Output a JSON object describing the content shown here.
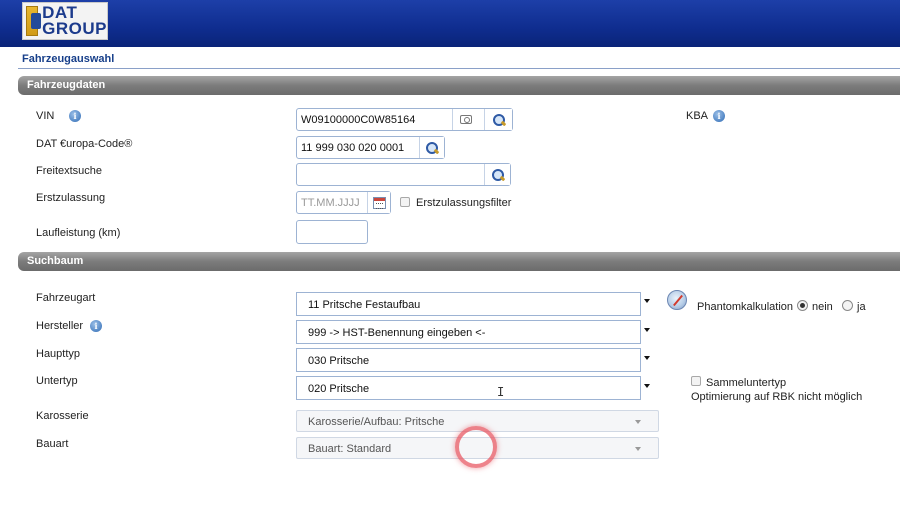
{
  "header": {
    "logo_line1": "DAT",
    "logo_line2": "GROUP",
    "page_title": "Fahrzeugauswahl"
  },
  "sections": {
    "vehicle_data": "Fahrzeugdaten",
    "search_tree": "Suchbaum"
  },
  "vehicle_data": {
    "vin_label": "VIN",
    "vin_value": "W09100000C0W85164",
    "kba_label": "KBA",
    "dat_code_label": "DAT €uropa-Code®",
    "dat_code_value": "11 999 030 020 0001",
    "freetext_label": "Freitextsuche",
    "freetext_value": "",
    "first_reg_label": "Erstzulassung",
    "first_reg_placeholder": "TT.MM.JJJJ",
    "first_reg_filter_label": "Erstzulassungsfilter",
    "mileage_label": "Laufleistung (km)",
    "mileage_value": ""
  },
  "search_tree": {
    "vehicle_type_label": "Fahrzeugart",
    "vehicle_type_value": "11 Pritsche Festaufbau",
    "manufacturer_label": "Hersteller",
    "manufacturer_value": "999 -> HST-Benennung eingeben <-",
    "main_type_label": "Haupttyp",
    "main_type_value": "030 Pritsche",
    "sub_type_label": "Untertyp",
    "sub_type_value": "020 Pritsche",
    "body_label": "Karosserie",
    "body_value": "Karosserie/Aufbau: Pritsche",
    "build_label": "Bauart",
    "build_value": "Bauart: Standard",
    "phantom_label": "Phantomkalkulation",
    "phantom_no": "nein",
    "phantom_yes": "ja",
    "collect_subtype_label": "Sammeluntertyp",
    "rbk_note": "Optimierung auf RBK nicht möglich"
  },
  "colors": {
    "header_blue": "#0f2d8f",
    "title_blue": "#173f8a",
    "section_gray": "#7c7c7c",
    "click_ring": "#e85a64"
  }
}
